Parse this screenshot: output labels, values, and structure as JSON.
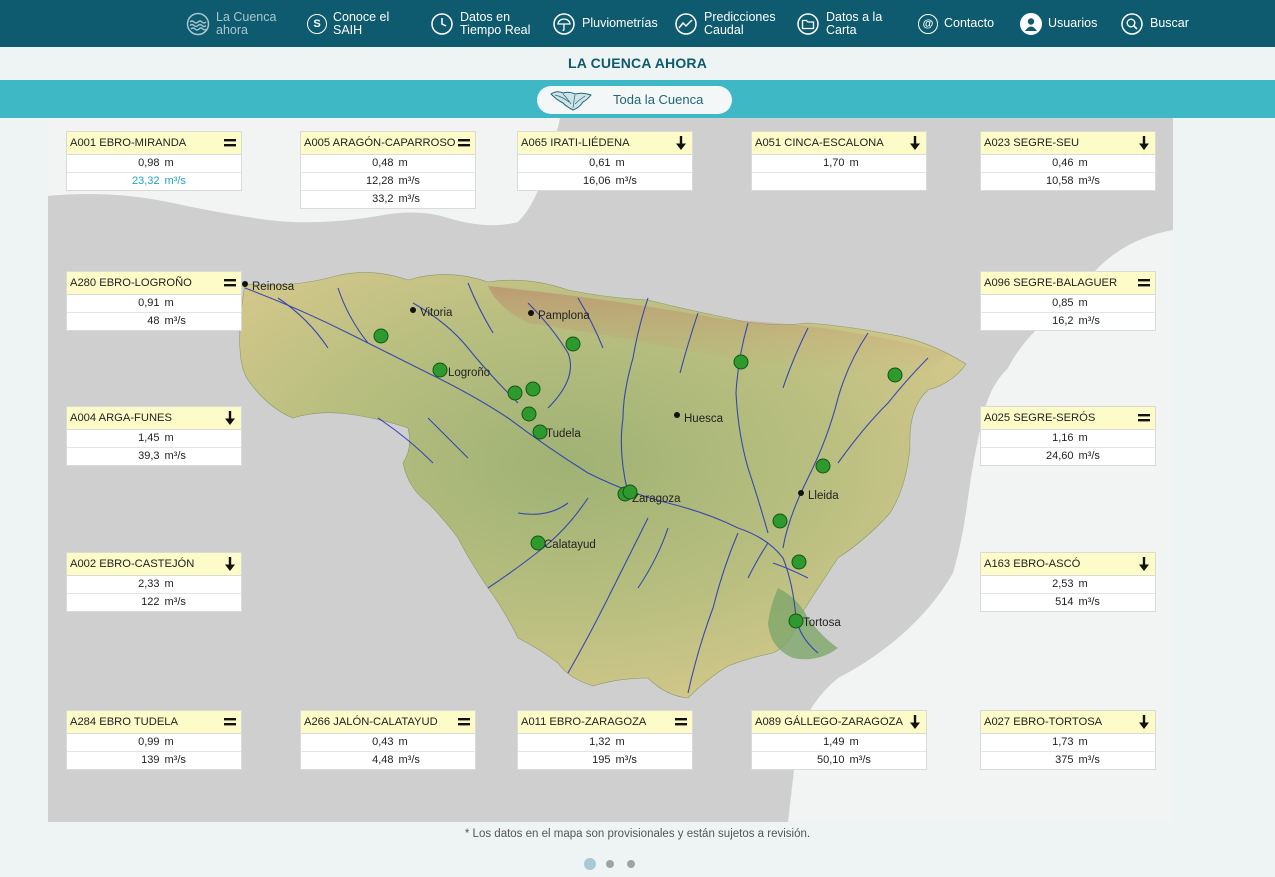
{
  "nav": {
    "items": [
      {
        "label": "La Cuenca\nahora",
        "icon": "waves-icon",
        "active": true
      },
      {
        "label": "Conoce el\nSAIH",
        "icon": "saih-icon"
      },
      {
        "label": "Datos en\nTiempo Real",
        "icon": "clock-icon"
      },
      {
        "label": "Pluviometrías",
        "icon": "umbrella-icon"
      },
      {
        "label": "Predicciones\nCaudal",
        "icon": "gauge-icon"
      },
      {
        "label": "Datos a la\nCarta",
        "icon": "folder-icon"
      },
      {
        "label": "Contacto",
        "icon": "at-icon"
      },
      {
        "label": "Usuarios",
        "icon": "user-icon"
      },
      {
        "label": "Buscar",
        "icon": "search-icon"
      }
    ]
  },
  "page_title": "LA CUENCA AHORA",
  "basin_button": {
    "label": "Toda la Cuenca",
    "icon": "basin-map-icon"
  },
  "map": {
    "cities": [
      "Reinosa",
      "Vitoria",
      "Pamplona",
      "Logroño",
      "Huesca",
      "Tudela",
      "Lleida",
      "Zaragoza",
      "Calatayud",
      "Tortosa"
    ]
  },
  "stations": [
    {
      "name": "A001 EBRO-MIRANDA",
      "trend": "equal",
      "rows": [
        {
          "value": "0,98",
          "unit": "m"
        },
        {
          "value": "23,32",
          "unit": "m³/s",
          "highlight": true
        }
      ]
    },
    {
      "name": "A005 ARAGÓN-CAPARROSO",
      "trend": "equal",
      "rows": [
        {
          "value": "0,48",
          "unit": "m"
        },
        {
          "value": "12,28",
          "unit": "m³/s"
        },
        {
          "value": "33,2",
          "unit": "m³/s"
        }
      ]
    },
    {
      "name": "A065 IRATI-LIÉDENA",
      "trend": "down",
      "rows": [
        {
          "value": "0,61",
          "unit": "m"
        },
        {
          "value": "16,06",
          "unit": "m³/s"
        }
      ]
    },
    {
      "name": "A051 CINCA-ESCALONA",
      "trend": "down",
      "rows": [
        {
          "value": "1,70",
          "unit": "m"
        },
        {
          "value": "",
          "unit": ""
        }
      ]
    },
    {
      "name": "A023 SEGRE-SEU",
      "trend": "down",
      "rows": [
        {
          "value": "0,46",
          "unit": "m"
        },
        {
          "value": "10,58",
          "unit": "m³/s"
        }
      ]
    },
    {
      "name": "A280 EBRO-LOGROÑO",
      "trend": "equal",
      "rows": [
        {
          "value": "0,91",
          "unit": "m"
        },
        {
          "value": "48",
          "unit": "m³/s"
        }
      ]
    },
    {
      "name": "A096 SEGRE-BALAGUER",
      "trend": "equal",
      "rows": [
        {
          "value": "0,85",
          "unit": "m"
        },
        {
          "value": "16,2",
          "unit": "m³/s"
        }
      ]
    },
    {
      "name": "A004 ARGA-FUNES",
      "trend": "down",
      "rows": [
        {
          "value": "1,45",
          "unit": "m"
        },
        {
          "value": "39,3",
          "unit": "m³/s"
        }
      ]
    },
    {
      "name": "A025 SEGRE-SERÓS",
      "trend": "equal",
      "rows": [
        {
          "value": "1,16",
          "unit": "m"
        },
        {
          "value": "24,60",
          "unit": "m³/s"
        }
      ]
    },
    {
      "name": "A002 EBRO-CASTEJÓN",
      "trend": "down",
      "rows": [
        {
          "value": "2,33",
          "unit": "m"
        },
        {
          "value": "122",
          "unit": "m³/s"
        }
      ]
    },
    {
      "name": "A163 EBRO-ASCÓ",
      "trend": "down",
      "rows": [
        {
          "value": "2,53",
          "unit": "m"
        },
        {
          "value": "514",
          "unit": "m³/s"
        }
      ]
    },
    {
      "name": "A284 EBRO TUDELA",
      "trend": "equal",
      "rows": [
        {
          "value": "0,99",
          "unit": "m"
        },
        {
          "value": "139",
          "unit": "m³/s"
        }
      ]
    },
    {
      "name": "A266 JALÓN-CALATAYUD",
      "trend": "equal",
      "rows": [
        {
          "value": "0,43",
          "unit": "m"
        },
        {
          "value": "4,48",
          "unit": "m³/s"
        }
      ]
    },
    {
      "name": "A011 EBRO-ZARAGOZA",
      "trend": "equal",
      "rows": [
        {
          "value": "1,32",
          "unit": "m"
        },
        {
          "value": "195",
          "unit": "m³/s"
        }
      ]
    },
    {
      "name": "A089 GÁLLEGO-ZARAGOZA",
      "trend": "down",
      "rows": [
        {
          "value": "1,49",
          "unit": "m"
        },
        {
          "value": "50,10",
          "unit": "m³/s"
        }
      ]
    },
    {
      "name": "A027 EBRO-TORTOSA",
      "trend": "down",
      "rows": [
        {
          "value": "1,73",
          "unit": "m"
        },
        {
          "value": "375",
          "unit": "m³/s"
        }
      ]
    }
  ],
  "colors": {
    "nav_bg": "#0e5a6e",
    "subbar": "#3fb8c6",
    "card_header": "#fdfcc9",
    "station_marker": "#2e9a2e",
    "highlight_value": "#1fa6c4"
  },
  "disclaimer": "* Los datos en el mapa son provisionales y están sujetos a revisión.",
  "pager": {
    "pages": 3,
    "current": 1
  }
}
